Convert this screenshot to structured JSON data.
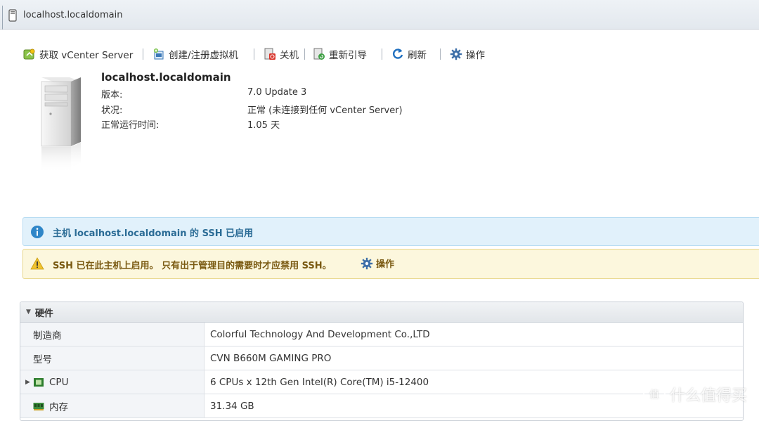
{
  "window": {
    "title": "localhost.localdomain"
  },
  "toolbar": [
    {
      "label": "获取 vCenter Server",
      "icon": "vcenter-icon"
    },
    {
      "label": "创建/注册虚拟机",
      "icon": "create-vm-icon"
    },
    {
      "label": "关机",
      "icon": "shutdown-icon"
    },
    {
      "label": "重新引导",
      "icon": "reboot-icon"
    },
    {
      "label": "刷新",
      "icon": "refresh-icon"
    },
    {
      "label": "操作",
      "icon": "gear-icon"
    }
  ],
  "host": {
    "name": "localhost.localdomain",
    "props": [
      {
        "label": "版本:",
        "value": "7.0 Update 3"
      },
      {
        "label": "状况:",
        "value": "正常 (未连接到任何 vCenter Server)"
      },
      {
        "label": "正常运行时间:",
        "value": "1.05 天"
      }
    ]
  },
  "alerts": {
    "info": "主机 localhost.localdomain 的 SSH 已启用",
    "warning": "SSH 已在此主机上启用。 只有出于管理目的需要时才应禁用 SSH。",
    "warning_action": "操作"
  },
  "hardware": {
    "title": "硬件",
    "rows": [
      {
        "key": "制造商",
        "value": "Colorful Technology And Development Co.,LTD"
      },
      {
        "key": "型号",
        "value": "CVN B660M GAMING PRO"
      },
      {
        "key": "CPU",
        "value": "6 CPUs x 12th Gen Intel(R) Core(TM) i5-12400"
      },
      {
        "key": "内存",
        "value": "31.34 GB"
      }
    ]
  },
  "watermark": "什么值得买",
  "colors": {
    "info_bg": "#e1f1fb",
    "warn_bg": "#fcf7dd",
    "accent": "#2b6c96"
  }
}
